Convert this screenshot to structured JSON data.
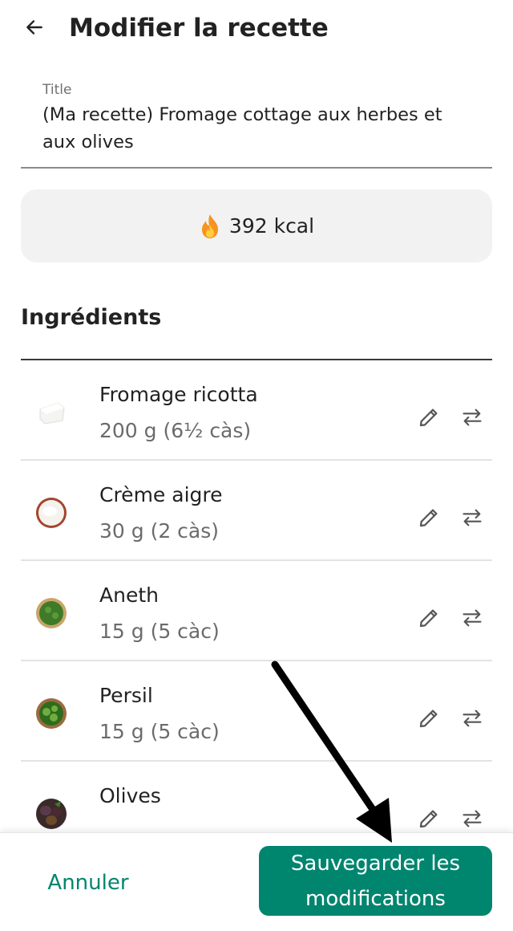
{
  "header": {
    "title": "Modifier la recette"
  },
  "title_field": {
    "label": "Title",
    "value": "(Ma recette) Fromage cottage aux herbes et aux olives"
  },
  "nutrition": {
    "kcal": "392 kcal"
  },
  "ingredients": {
    "heading": "Ingrédients",
    "items": [
      {
        "name": "Fromage ricotta",
        "qty": "200 g (6½ càs)"
      },
      {
        "name": "Crème aigre",
        "qty": "30 g (2 càs)"
      },
      {
        "name": "Aneth",
        "qty": "15 g (5 càc)"
      },
      {
        "name": "Persil",
        "qty": "15 g (5 càc)"
      },
      {
        "name": "Olives",
        "qty": ""
      }
    ]
  },
  "footer": {
    "cancel_label": "Annuler",
    "save_label": "Sauvegarder les modifications"
  },
  "colors": {
    "accent": "#00856f",
    "card": "#f2f2f2",
    "text": "#222222",
    "muted": "#6b6b6b"
  }
}
